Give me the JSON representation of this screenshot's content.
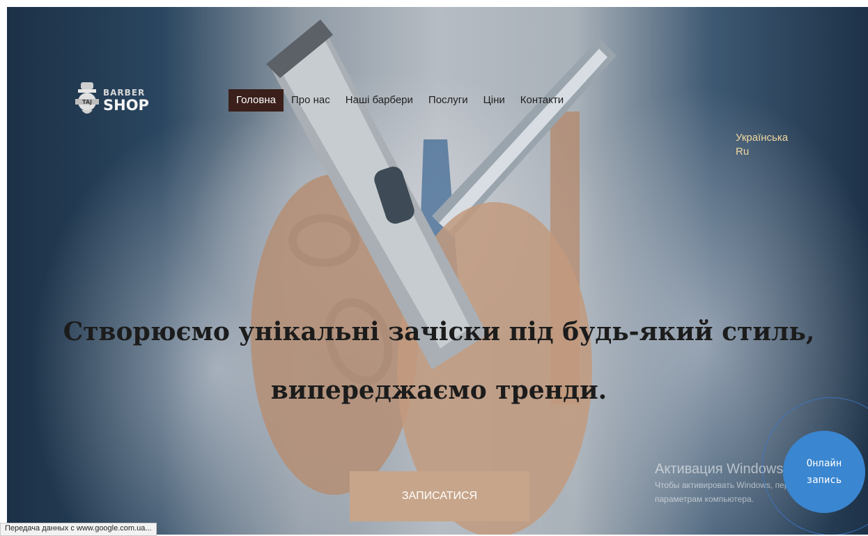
{
  "logo": {
    "line1": "BARBER",
    "line2": "SHOP",
    "badge_text": "TAJ"
  },
  "nav": {
    "items": [
      {
        "label": "Головна",
        "active": true
      },
      {
        "label": "Про нас"
      },
      {
        "label": "Наші барбери"
      },
      {
        "label": "Послуги"
      },
      {
        "label": "Ціни"
      },
      {
        "label": "Контакти"
      }
    ]
  },
  "language": {
    "ua": "Українська",
    "ru": "Ru"
  },
  "hero": {
    "headline": "Створюємо унікальні зачіски під будь-який стиль, випереджаємо тренди.",
    "cta_label": "ЗАПИСАТИСЯ"
  },
  "online_booking": {
    "line1": "Онлайн",
    "line2": "запись"
  },
  "windows_watermark": {
    "title": "Активация Windows",
    "subtitle": "Чтобы активировать Windows, перейдите к параметрам компьютера."
  },
  "status_bar": {
    "text": "Передача данных с www.google.com.ua..."
  },
  "colors": {
    "nav_active_bg": "#3a1f1a",
    "cta_bg": "#c7a58a",
    "language_text": "#f1d8a0",
    "online_button_bg": "#3a86d0"
  },
  "icons": {
    "logo_badge": "barber-logo-icon"
  }
}
